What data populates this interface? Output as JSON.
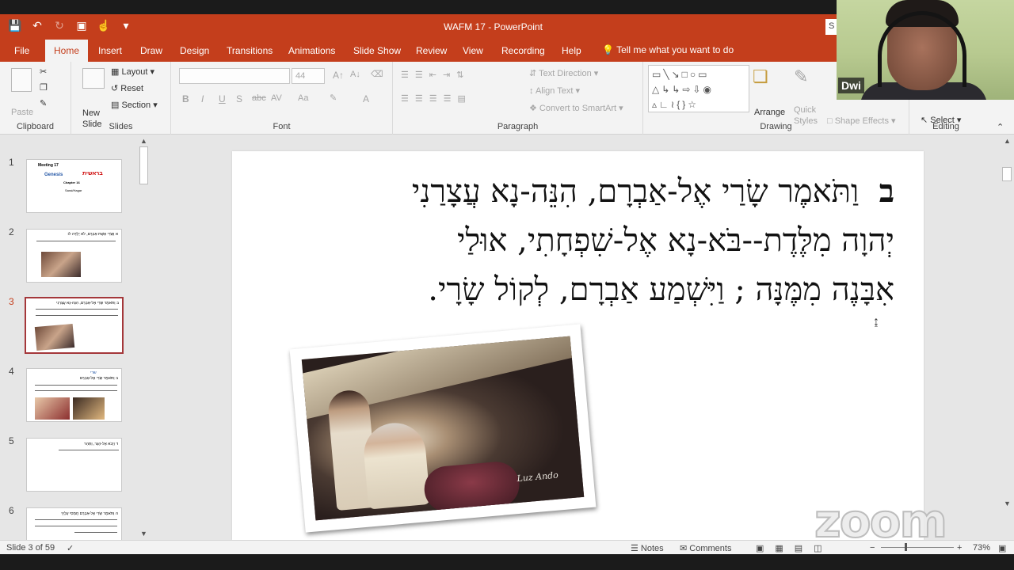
{
  "app": {
    "window_title": "WAFM 17 - PowerPoint",
    "accent": "#c43e1c",
    "sign_in": "S"
  },
  "tabs": [
    "File",
    "Home",
    "Insert",
    "Draw",
    "Design",
    "Transitions",
    "Animations",
    "Slide Show",
    "Review",
    "View",
    "Recording",
    "Help"
  ],
  "tell_me": "Tell me what you want to do",
  "ribbon": {
    "clipboard": {
      "paste": "Paste",
      "label": "Clipboard"
    },
    "slides": {
      "new_slide": "New Slide",
      "layout": "Layout",
      "reset": "Reset",
      "section": "Section",
      "label": "Slides"
    },
    "font": {
      "size": "44",
      "bold": "B",
      "italic": "I",
      "underline": "U",
      "strike": "S",
      "shadow": "abc",
      "spacing": "AV",
      "case": "Aa",
      "color": "A",
      "label": "Font"
    },
    "paragraph": {
      "text_direction": "Text Direction",
      "align_text": "Align Text",
      "smartart": "Convert to SmartArt",
      "label": "Paragraph"
    },
    "drawing": {
      "arrange": "Arrange",
      "quick_styles": "Quick Styles",
      "shape_effects": "Shape Effects",
      "label": "Drawing"
    },
    "editing": {
      "select": "Select",
      "label": "Editing"
    }
  },
  "thumbnails": [
    {
      "num": "1",
      "lines": [
        "Meeting 17",
        "בראשית",
        "Genesis",
        "Chapter 16",
        "Sarai/Hagar"
      ]
    },
    {
      "num": "2",
      "lines": [
        "א וְשָׂרַי אֵשֶׁת אַבְרָם, לֹא יָלְדָה לוֹ"
      ]
    },
    {
      "num": "3",
      "lines": [
        "ב וַתֹּאמֶר שָׂרַי אֶל-אַבְרָם, הִנֵּה-נָא עֲצָרַנִי"
      ]
    },
    {
      "num": "4",
      "lines": [
        "שרי",
        "ב וַתֹּאמֶר שָׂרַי אֶל-אַבְרָם"
      ]
    },
    {
      "num": "5",
      "lines": [
        "ד וַיָּבֹא אֶל-הָגָר, וַתַּהַר"
      ]
    },
    {
      "num": "6",
      "lines": [
        "ה וַתֹּאמֶר שָׂרַי אֶל-אַבְרָם חֲמָסִי עָלֶיךָ"
      ]
    }
  ],
  "slide": {
    "verse_number": "ב",
    "lines": [
      "וַתֹּאמֶר שָׂרַי אֶל-אַבְרָם, הִנֵּה-נָא עֲצָרַנִי",
      "יְהוָה מִלֶּדֶת--בֹּא-נָא אֶל-שִׁפְחָתִי, אוּלַי",
      "אִבָּנֶה מִמֶּנָּה ; וַיִּשְׁמַע אַבְרָם, לְקוֹל שָׂרָי."
    ],
    "image_signature": "Luz Ando"
  },
  "status": {
    "slide_info": "Slide 3 of 59",
    "notes": "Notes",
    "comments": "Comments",
    "zoom_minus": "−",
    "zoom_plus": "+",
    "zoom": "73%"
  },
  "webcam": {
    "name": "Dwi"
  },
  "watermark": "zoom"
}
